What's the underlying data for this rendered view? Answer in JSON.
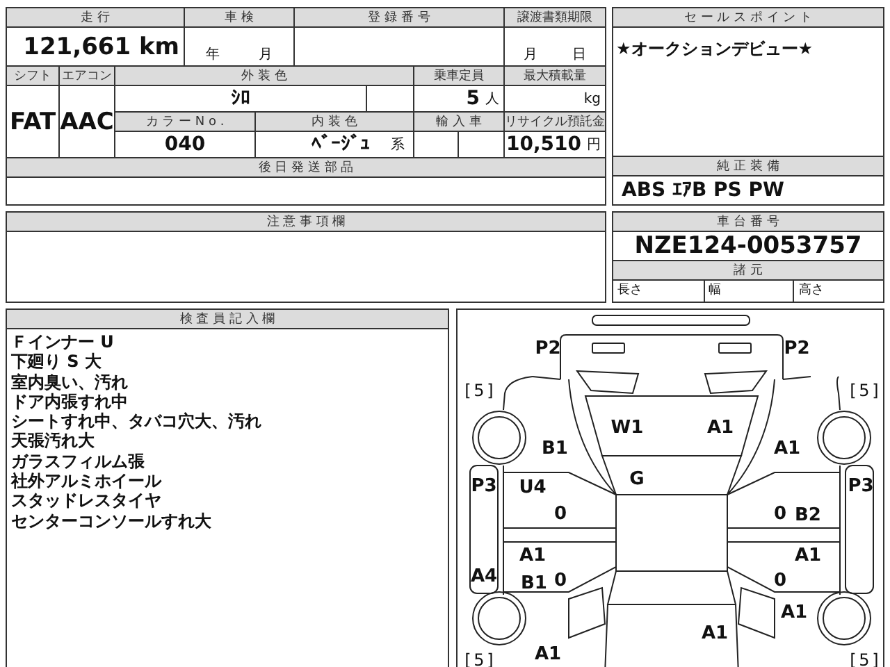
{
  "vehicle_info": {
    "mileage_label": "走 行",
    "mileage": "121,661 km",
    "inspection_label": "車 検",
    "inspection_year_unit": "年",
    "inspection_month_unit": "月",
    "registration_label": "登 録 番 号",
    "transfer_deadline_label": "譲渡書類期限",
    "transfer_month_unit": "月",
    "transfer_day_unit": "日",
    "shift_label": "シフト",
    "shift": "FAT",
    "aircon_label": "エアコン",
    "aircon": "AAC",
    "exterior_color_label": "外 装 色",
    "exterior_color": "ｼﾛ",
    "capacity_label": "乗車定員",
    "capacity": "5",
    "capacity_unit": "人",
    "max_load_label": "最大積載量",
    "max_load_unit": "kg",
    "color_no_label": "カ ラ ー N o .",
    "color_no": "040",
    "interior_color_label": "内 装 色",
    "interior_color": "ﾍﾞｰｼﾞｭ",
    "interior_color_suffix": "系",
    "import_label": "輸 入 車",
    "recycle_fee_label": "リサイクル預託金",
    "recycle_fee": "10,510",
    "recycle_fee_unit": "円"
  },
  "parts_to_ship": {
    "label": "後 日 発 送 部 品"
  },
  "notes": {
    "label": "注 意 事 項 欄"
  },
  "sales_point": {
    "label": "セ ー ル ス ポ イ ン ト",
    "text": "★オークションデビュー★"
  },
  "standard_equipment": {
    "label": "純 正 装 備",
    "text": "ABS ｴｱB PS PW"
  },
  "chassis": {
    "label": "車 台 番 号",
    "number": "NZE124-0053757"
  },
  "specs": {
    "label": "諸 元",
    "columns": [
      "長さ",
      "幅",
      "高さ"
    ]
  },
  "inspector_notes": {
    "label": "検 査 員 記 入 欄",
    "lines": [
      "Ｆインナー U",
      "下廻り S 大",
      "室内臭い、汚れ",
      "ドア内張すれ中",
      "シートすれ中、タバコ穴大、汚れ",
      "天張汚れ大",
      "ガラスフィルム張",
      "社外アルミホイール",
      "スタッドレスタイヤ",
      "センターコンソールすれ大"
    ]
  },
  "damage_map": {
    "tread_depths": [
      "[ 5 ]",
      "[ 5 ]",
      "[ 5 ]",
      "[ 5 ]"
    ],
    "marks": [
      "P2",
      "P2",
      "W1",
      "A1",
      "B1",
      "A1",
      "G",
      "P3",
      "U4",
      "P3",
      "0",
      "0",
      "B2",
      "A1",
      "A1",
      "A4",
      "B1",
      "0",
      "0",
      "A1",
      "A1",
      "A1"
    ]
  }
}
